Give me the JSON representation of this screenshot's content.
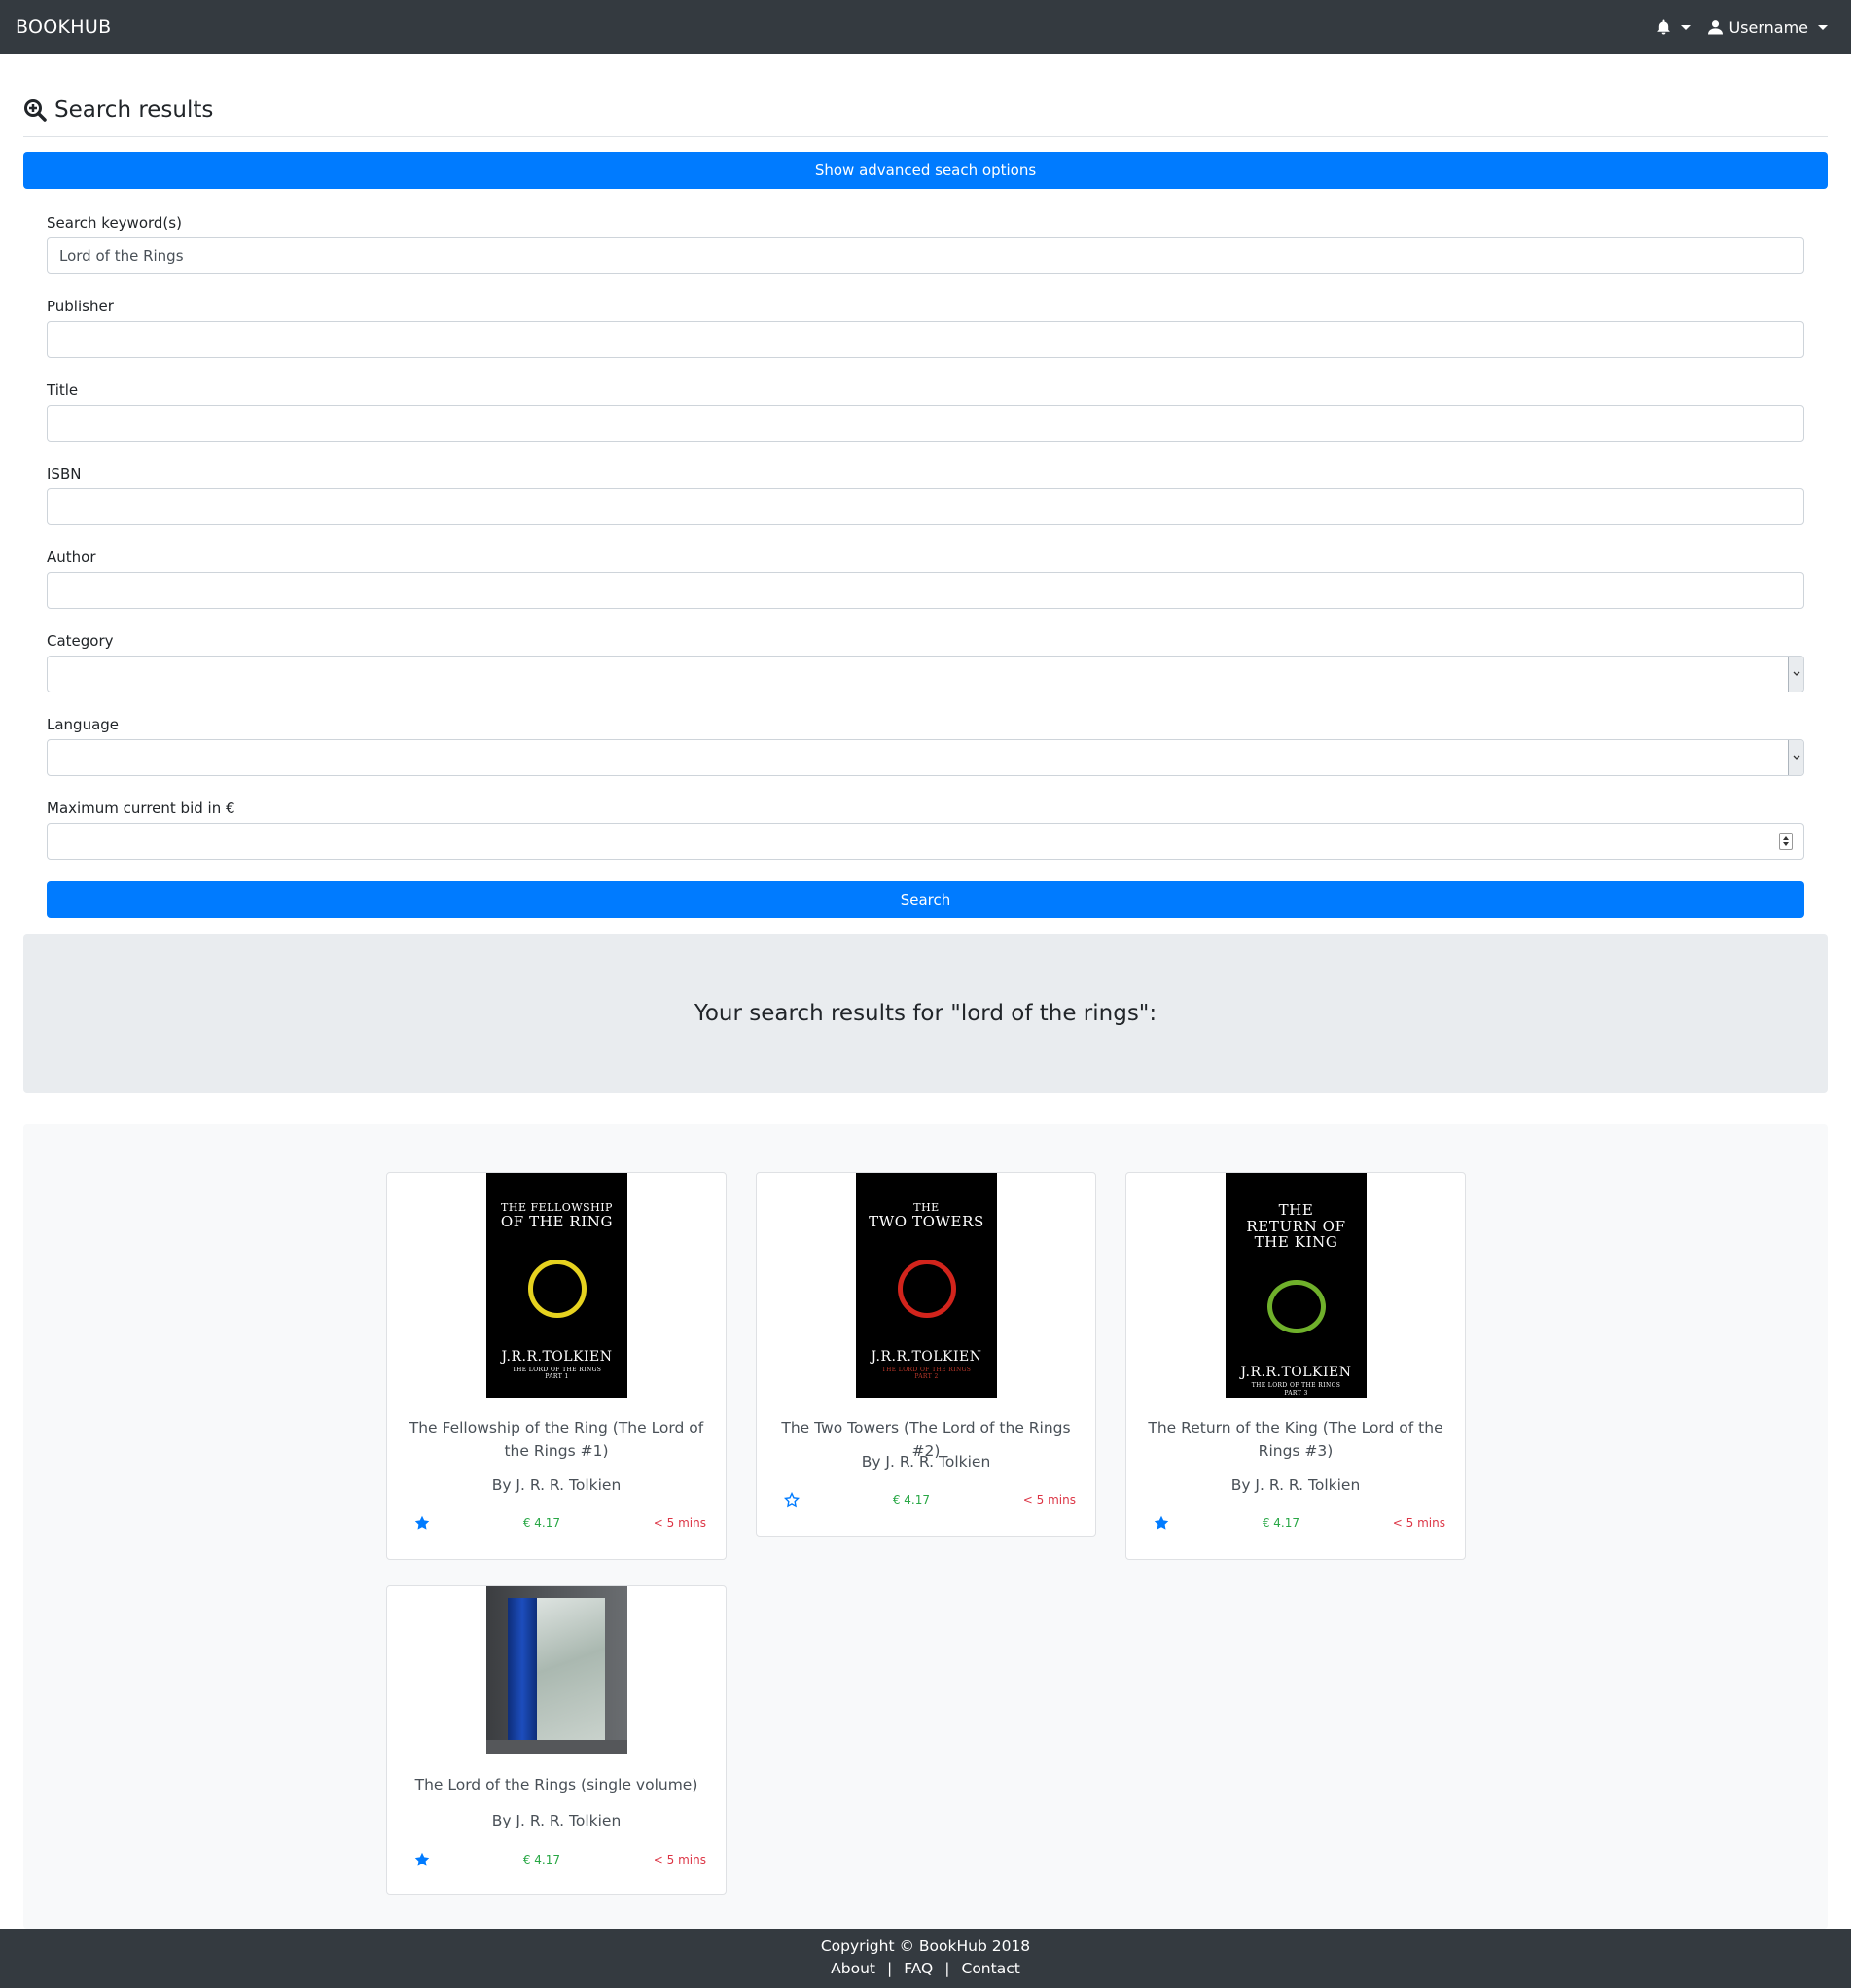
{
  "navbar": {
    "brand": "BOOKHUB",
    "username": "Username"
  },
  "page": {
    "title": "Search results",
    "toggle_label": "Show advanced seach options"
  },
  "form": {
    "keywords": {
      "label": "Search keyword(s)",
      "value": "Lord of the Rings"
    },
    "publisher": {
      "label": "Publisher",
      "value": ""
    },
    "title": {
      "label": "Title",
      "value": ""
    },
    "isbn": {
      "label": "ISBN",
      "value": ""
    },
    "author": {
      "label": "Author",
      "value": ""
    },
    "category": {
      "label": "Category",
      "value": ""
    },
    "language": {
      "label": "Language",
      "value": ""
    },
    "max_bid": {
      "label": "Maximum current bid in €",
      "value": ""
    },
    "search_label": "Search"
  },
  "results_heading": "Your search results for \"lord of the rings\":",
  "books": [
    {
      "title": "The Fellowship of the Ring (The Lord of the Rings #1)",
      "author": "By J. R. R. Tolkien",
      "price": "€ 4.17",
      "time_left": "< 5 mins",
      "favorited": true,
      "cover": {
        "small": "THE FELLOWSHIP",
        "big": "OF THE RING",
        "author": "J.R.R.TOLKIEN",
        "series": "THE LORD OF THE RINGS",
        "part": "PART 1",
        "ring_color": "#e6d21f"
      }
    },
    {
      "title": "The Two Towers (The Lord of the Rings #2)",
      "author": "By J. R. R. Tolkien",
      "price": "€ 4.17",
      "time_left": "< 5 mins",
      "favorited": false,
      "cover": {
        "small": "THE",
        "big": "TWO TOWERS",
        "author": "J.R.R.TOLKIEN",
        "series": "THE LORD OF THE RINGS",
        "part": "PART 2",
        "ring_color": "#d2241c"
      }
    },
    {
      "title": "The Return of the King (The Lord of the Rings #3)",
      "author": "By J. R. R. Tolkien",
      "price": "€ 4.17",
      "time_left": "< 5 mins",
      "favorited": true,
      "cover": {
        "small": "",
        "big": "THE RETURN OF THE KING",
        "author": "J.R.R.TOLKIEN",
        "series": "THE LORD OF THE RINGS",
        "part": "PART 3",
        "ring_color": "#6fb02b"
      }
    },
    {
      "title": "The Lord of the Rings (single volume)",
      "author": "By J. R. R. Tolkien",
      "price": "€ 4.17",
      "time_left": "< 5 mins",
      "favorited": true
    }
  ],
  "footer": {
    "copyright": "Copyright © BookHub 2018",
    "links": [
      "About",
      "FAQ",
      "Contact"
    ],
    "separator": "|"
  },
  "colors": {
    "navbar": "#343a40",
    "primary": "#007bff",
    "price": "#28a745",
    "time": "#dc3545",
    "jumbotron": "#e9ecef"
  }
}
